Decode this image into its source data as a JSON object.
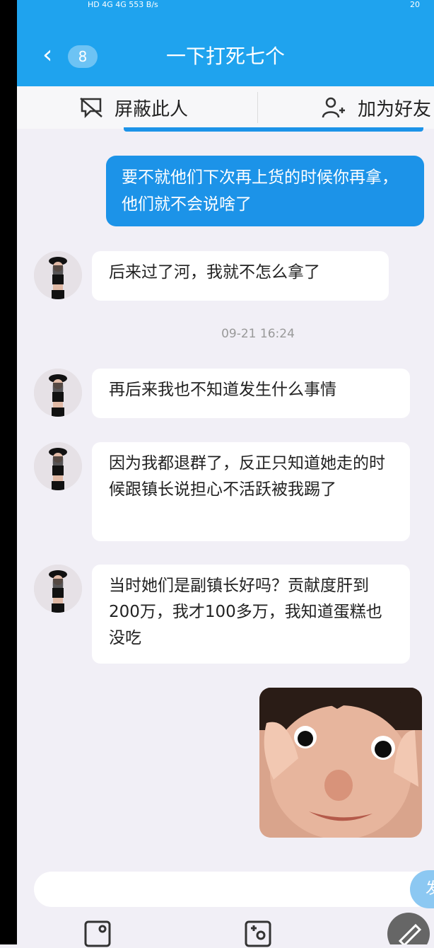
{
  "status_bar": {
    "left": "HD 4G 4G 553 B/s",
    "battery": "20"
  },
  "header": {
    "back_count": "8",
    "title": "一下打死七个"
  },
  "toolbar": {
    "block_label": "屏蔽此人",
    "add_friend_label": "加为好友"
  },
  "messages": [
    {
      "sender": "me",
      "text": "要不就他们下次再上货的时候你再拿，他们就不会说啥了"
    },
    {
      "sender": "other",
      "text": "后来过了河，我就不怎么拿了"
    },
    {
      "sender": "other",
      "text": "再后来我也不知道发生什么事情"
    },
    {
      "sender": "other",
      "text": "因为我都退群了，反正只知道她走的时候跟镇长说担心不活跃被我踢了"
    },
    {
      "sender": "other",
      "text": "当时她们是副镇长好吗？贡献度肝到200万，我才100多万，我知道蛋糕也没吃"
    }
  ],
  "timestamp": "09-21 16:24",
  "input": {
    "send_label": "发"
  }
}
